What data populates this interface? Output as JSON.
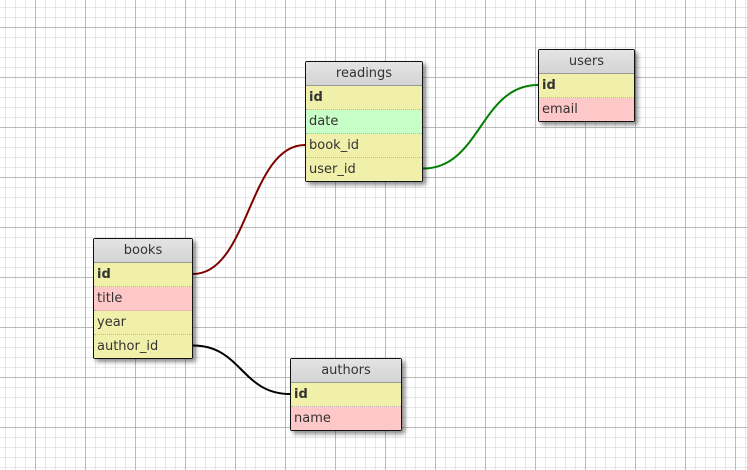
{
  "tables": {
    "readings": {
      "title": "readings",
      "fields": [
        {
          "name": "id",
          "key": true,
          "color": "#f0f0aa"
        },
        {
          "name": "date",
          "key": false,
          "color": "#c8ffc8"
        },
        {
          "name": "book_id",
          "key": false,
          "color": "#f0f0aa"
        },
        {
          "name": "user_id",
          "key": false,
          "color": "#f0f0aa"
        }
      ]
    },
    "users": {
      "title": "users",
      "fields": [
        {
          "name": "id",
          "key": true,
          "color": "#f0f0aa"
        },
        {
          "name": "email",
          "key": false,
          "color": "#ffc8c8"
        }
      ]
    },
    "books": {
      "title": "books",
      "fields": [
        {
          "name": "id",
          "key": true,
          "color": "#f0f0aa"
        },
        {
          "name": "title",
          "key": false,
          "color": "#ffc8c8"
        },
        {
          "name": "year",
          "key": false,
          "color": "#f0f0aa"
        },
        {
          "name": "author_id",
          "key": false,
          "color": "#f0f0aa"
        }
      ]
    },
    "authors": {
      "title": "authors",
      "fields": [
        {
          "name": "id",
          "key": true,
          "color": "#f0f0aa"
        },
        {
          "name": "name",
          "key": false,
          "color": "#ffc8c8"
        }
      ]
    }
  },
  "relations": [
    {
      "from_table": "books",
      "from_field": "id",
      "to_table": "readings",
      "to_field": "book_id",
      "color": "#800000"
    },
    {
      "from_table": "readings",
      "from_field": "user_id",
      "to_table": "users",
      "to_field": "id",
      "color": "#008000"
    },
    {
      "from_table": "books",
      "from_field": "author_id",
      "to_table": "authors",
      "to_field": "id",
      "color": "#000000"
    }
  ]
}
